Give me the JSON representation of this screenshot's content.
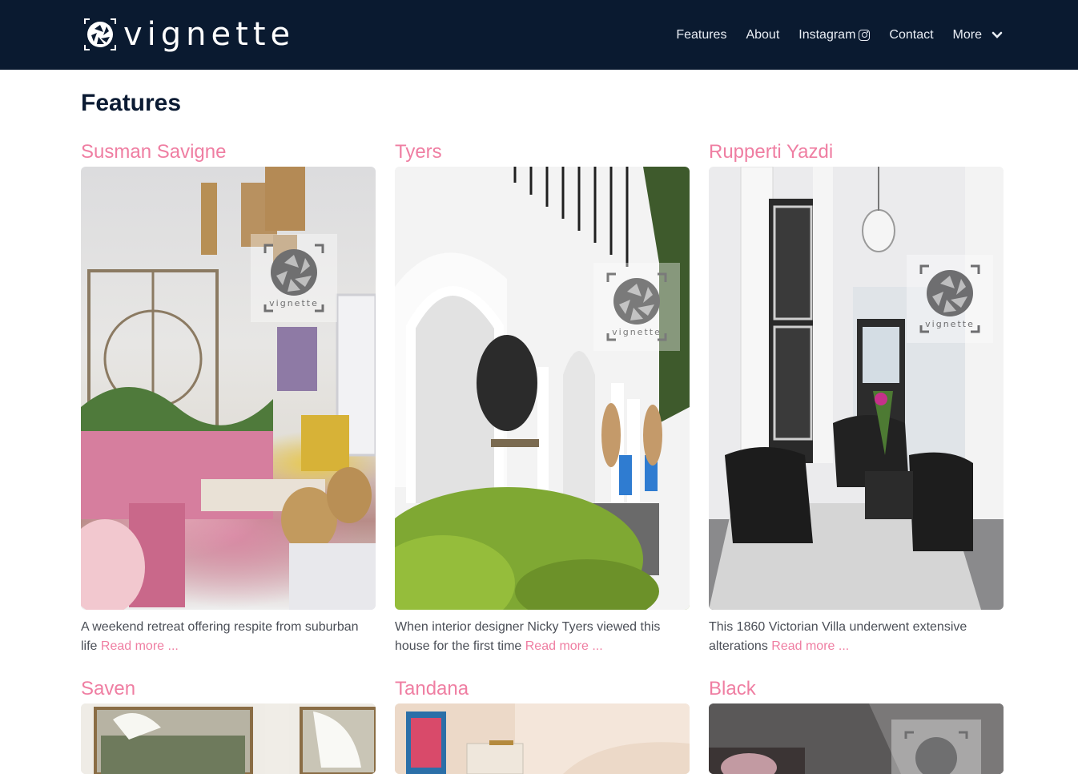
{
  "brand": {
    "name": "vignette",
    "watermark": "vignette"
  },
  "nav": {
    "items": [
      "Features",
      "About",
      "Instagram",
      "Contact"
    ],
    "more_label": "More"
  },
  "page": {
    "title": "Features"
  },
  "cards": [
    {
      "title": "Susman Savigne",
      "desc": "A weekend retreat offering respite from suburban life",
      "link": "Read more ..."
    },
    {
      "title": "Tyers",
      "desc": "When interior designer Nicky Tyers viewed this house for the first time",
      "link": "Read more ..."
    },
    {
      "title": "Rupperti Yazdi",
      "desc": "This 1860 Victorian Villa underwent extensive alterations",
      "link": "Read more ..."
    },
    {
      "title": "Saven"
    },
    {
      "title": "Tandana"
    },
    {
      "title": "Black"
    }
  ],
  "colors": {
    "header_bg": "#0a1a30",
    "accent": "#ef7ea2",
    "text": "#4b4f57"
  }
}
